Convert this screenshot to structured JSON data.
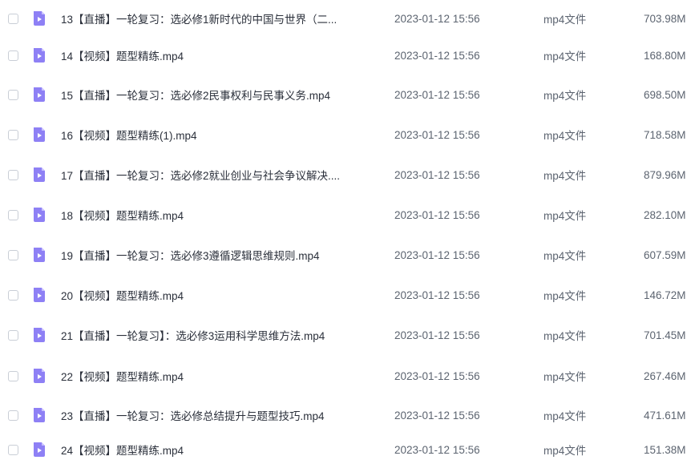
{
  "file_icon": "video-file-icon",
  "colors": {
    "icon_primary": "#8e80f5",
    "icon_fold": "#c9c1ff",
    "text_primary": "#2b303b",
    "text_secondary": "#5c6470"
  },
  "files": [
    {
      "name": "13【直播】一轮复习：选必修1新时代的中国与世界（二...",
      "date": "2023-01-12 15:56",
      "type": "mp4文件",
      "size": "703.98M"
    },
    {
      "name": "14【视频】题型精练.mp4",
      "date": "2023-01-12 15:56",
      "type": "mp4文件",
      "size": "168.80M"
    },
    {
      "name": "15【直播】一轮复习：选必修2民事权利与民事义务.mp4",
      "date": "2023-01-12 15:56",
      "type": "mp4文件",
      "size": "698.50M"
    },
    {
      "name": "16【视频】题型精练(1).mp4",
      "date": "2023-01-12 15:56",
      "type": "mp4文件",
      "size": "718.58M"
    },
    {
      "name": "17【直播】一轮复习：选必修2就业创业与社会争议解决....",
      "date": "2023-01-12 15:56",
      "type": "mp4文件",
      "size": "879.96M"
    },
    {
      "name": "18【视频】题型精练.mp4",
      "date": "2023-01-12 15:56",
      "type": "mp4文件",
      "size": "282.10M"
    },
    {
      "name": "19【直播】一轮复习：选必修3遵循逻辑思维规则.mp4",
      "date": "2023-01-12 15:56",
      "type": "mp4文件",
      "size": "607.59M"
    },
    {
      "name": "20【视频】题型精练.mp4",
      "date": "2023-01-12 15:56",
      "type": "mp4文件",
      "size": "146.72M"
    },
    {
      "name": "21【直播】一轮复习】：选必修3运用科学思维方法.mp4",
      "date": "2023-01-12 15:56",
      "type": "mp4文件",
      "size": "701.45M"
    },
    {
      "name": "22【视频】题型精练.mp4",
      "date": "2023-01-12 15:56",
      "type": "mp4文件",
      "size": "267.46M"
    },
    {
      "name": "23【直播】一轮复习：选必修总结提升与题型技巧.mp4",
      "date": "2023-01-12 15:56",
      "type": "mp4文件",
      "size": "471.61M"
    },
    {
      "name": "24【视频】题型精练.mp4",
      "date": "2023-01-12 15:56",
      "type": "mp4文件",
      "size": "151.38M"
    }
  ]
}
